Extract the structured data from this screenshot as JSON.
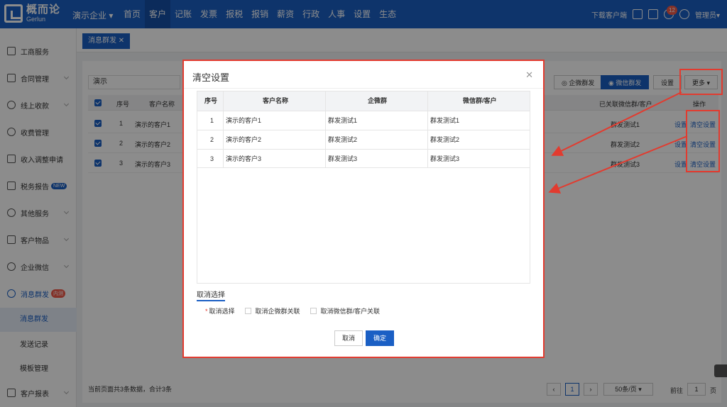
{
  "brand": {
    "name_cn": "概而论",
    "name_en": "Gerlun"
  },
  "company": "演示企业",
  "nav": [
    "首页",
    "客户",
    "记账",
    "发票",
    "报税",
    "报销",
    "薪资",
    "行政",
    "人事",
    "设置",
    "生态"
  ],
  "nav_active": 1,
  "topbar": {
    "download": "下载客户端",
    "badge": "12",
    "user": "管理员"
  },
  "sidebar": {
    "items": [
      {
        "label": "工商服务"
      },
      {
        "label": "合同管理"
      },
      {
        "label": "线上收款"
      },
      {
        "label": "收费管理"
      },
      {
        "label": "收入调整申请"
      },
      {
        "label": "税务报告",
        "tag": "NEW"
      },
      {
        "label": "其他服务"
      },
      {
        "label": "客户物品"
      },
      {
        "label": "企业微信"
      },
      {
        "label": "消息群发",
        "tag": "内测"
      }
    ],
    "subitems": [
      "消息群发",
      "发送记录",
      "模板管理"
    ],
    "last": "客户报表"
  },
  "tab": "消息群发",
  "toolbar": {
    "search": "演示",
    "btn_qw": "企微群发",
    "btn_wx": "微信群发",
    "btn_set": "设置",
    "btn_more": "更多"
  },
  "table": {
    "headers": [
      "序号",
      "客户名称",
      "已关联微信群/客户",
      "操作"
    ],
    "rows": [
      {
        "idx": "1",
        "name": "演示的客户1",
        "group": "群发测试1"
      },
      {
        "idx": "2",
        "name": "演示的客户2",
        "group": "群发测试2"
      },
      {
        "idx": "3",
        "name": "演示的客户3",
        "group": "群发测试3"
      }
    ],
    "op_set": "设置",
    "op_clear": "清空设置"
  },
  "footer": {
    "summary": "当前页面共3条数据，合计3条",
    "page": "1",
    "per_page": "50条/页",
    "goto": "前往",
    "goto_val": "1",
    "page_unit": "页"
  },
  "modal": {
    "title": "清空设置",
    "headers": [
      "序号",
      "客户名称",
      "企微群",
      "微信群/客户"
    ],
    "rows": [
      [
        "1",
        "演示的客户1",
        "群发测试1",
        "群发测试1"
      ],
      [
        "2",
        "演示的客户2",
        "群发测试2",
        "群发测试2"
      ],
      [
        "3",
        "演示的客户3",
        "群发测试3",
        "群发测试3"
      ]
    ],
    "section": "取消选择",
    "opt_label": "取消选择",
    "opt1": "取消企微群关联",
    "opt2": "取消微信群/客户关联",
    "cancel": "取消",
    "ok": "确定"
  },
  "colors": {
    "primary": "#1a5fc4",
    "highlight": "#e23b2f"
  }
}
